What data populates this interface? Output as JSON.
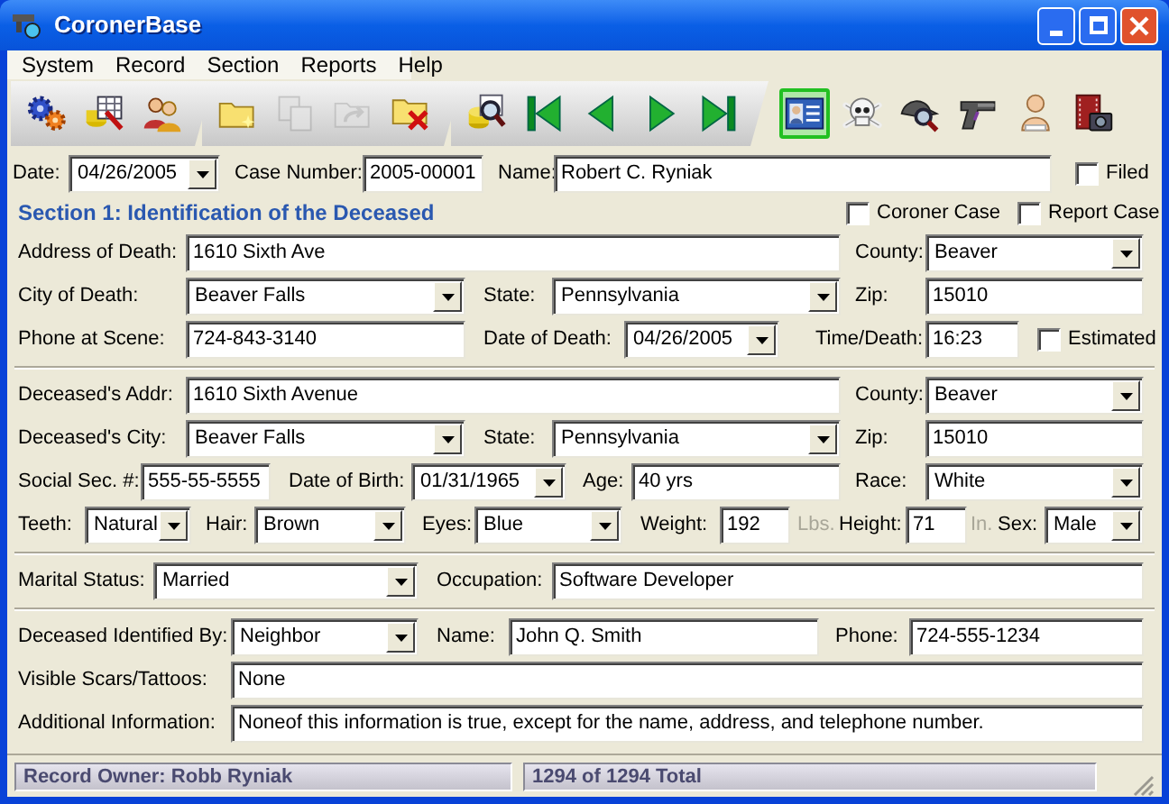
{
  "window": {
    "title": "CoronerBase"
  },
  "menu": [
    {
      "label": "System"
    },
    {
      "label": "Record"
    },
    {
      "label": "Section"
    },
    {
      "label": "Reports"
    },
    {
      "label": "Help"
    }
  ],
  "toolbar": [
    {
      "kind": "panel",
      "buttons": [
        {
          "kind": "gears",
          "disabled": false,
          "selected": false
        },
        {
          "kind": "table",
          "disabled": false,
          "selected": false
        },
        {
          "kind": "people",
          "disabled": false,
          "selected": false
        }
      ]
    },
    {
      "kind": "panel",
      "buttons": [
        {
          "kind": "folder-new",
          "disabled": false,
          "selected": false
        },
        {
          "kind": "copy",
          "disabled": true,
          "selected": false
        },
        {
          "kind": "folder-move",
          "disabled": true,
          "selected": false
        },
        {
          "kind": "folder-delete",
          "disabled": false,
          "selected": false
        }
      ]
    },
    {
      "kind": "panel",
      "buttons": [
        {
          "kind": "search-db",
          "disabled": false,
          "selected": false
        },
        {
          "kind": "first",
          "disabled": false,
          "selected": false
        },
        {
          "kind": "prev",
          "disabled": false,
          "selected": false
        },
        {
          "kind": "next",
          "disabled": false,
          "selected": false
        },
        {
          "kind": "last",
          "disabled": false,
          "selected": false
        }
      ]
    },
    {
      "kind": "flat",
      "buttons": [
        {
          "kind": "id-card",
          "disabled": false,
          "selected": true
        },
        {
          "kind": "skull",
          "disabled": false,
          "selected": false
        },
        {
          "kind": "hat-magnifier",
          "disabled": false,
          "selected": false
        },
        {
          "kind": "pistol",
          "disabled": false,
          "selected": false
        },
        {
          "kind": "baby",
          "disabled": false,
          "selected": false
        },
        {
          "kind": "film-camera",
          "disabled": false,
          "selected": false
        }
      ]
    }
  ],
  "rows": [
    {
      "kind": "fields",
      "items": [
        {
          "kind": "label",
          "text": "Date:"
        },
        {
          "kind": "combo",
          "value": "04/26/2005"
        },
        {
          "kind": "label",
          "text": "Case Number:"
        },
        {
          "kind": "text",
          "value": "2005-00001"
        },
        {
          "kind": "label",
          "text": "Name:"
        },
        {
          "kind": "text",
          "value": "Robert C. Ryniak"
        },
        {
          "kind": "checkbox",
          "label": "Filed",
          "checked": false
        }
      ]
    },
    {
      "kind": "section",
      "items": [
        {
          "kind": "title",
          "text": "Section 1: Identification of the Deceased"
        },
        {
          "kind": "checkbox",
          "label": "Coroner Case",
          "checked": false
        },
        {
          "kind": "checkbox",
          "label": "Report Case",
          "checked": false
        }
      ]
    },
    {
      "kind": "fields",
      "items": [
        {
          "kind": "label",
          "text": "Address of Death:"
        },
        {
          "kind": "text",
          "value": "1610 Sixth Ave"
        },
        {
          "kind": "label",
          "text": "County:"
        },
        {
          "kind": "combo",
          "value": "Beaver"
        }
      ]
    },
    {
      "kind": "fields",
      "items": [
        {
          "kind": "label",
          "text": "City of Death:"
        },
        {
          "kind": "combo",
          "value": "Beaver Falls"
        },
        {
          "kind": "label",
          "text": "State:"
        },
        {
          "kind": "combo",
          "value": "Pennsylvania"
        },
        {
          "kind": "label",
          "text": "Zip:"
        },
        {
          "kind": "text",
          "value": "15010"
        }
      ]
    },
    {
      "kind": "fields",
      "items": [
        {
          "kind": "label",
          "text": "Phone at Scene:"
        },
        {
          "kind": "text",
          "value": "724-843-3140"
        },
        {
          "kind": "label",
          "text": "Date of Death:"
        },
        {
          "kind": "combo",
          "value": "04/26/2005"
        },
        {
          "kind": "label",
          "text": "Time/Death:"
        },
        {
          "kind": "text",
          "value": "16:23"
        },
        {
          "kind": "checkbox",
          "label": "Estimated",
          "checked": false
        }
      ]
    },
    {
      "kind": "divider"
    },
    {
      "kind": "fields",
      "items": [
        {
          "kind": "label",
          "text": "Deceased's Addr:"
        },
        {
          "kind": "text",
          "value": "1610 Sixth Avenue"
        },
        {
          "kind": "label",
          "text": "County:"
        },
        {
          "kind": "combo",
          "value": "Beaver"
        }
      ]
    },
    {
      "kind": "fields",
      "items": [
        {
          "kind": "label",
          "text": "Deceased's City:"
        },
        {
          "kind": "combo",
          "value": "Beaver Falls"
        },
        {
          "kind": "label",
          "text": "State:"
        },
        {
          "kind": "combo",
          "value": "Pennsylvania"
        },
        {
          "kind": "label",
          "text": "Zip:"
        },
        {
          "kind": "text",
          "value": "15010"
        }
      ]
    },
    {
      "kind": "fields",
      "items": [
        {
          "kind": "label",
          "text": "Social Sec. #:"
        },
        {
          "kind": "text",
          "value": "555-55-5555"
        },
        {
          "kind": "label",
          "text": "Date of Birth:"
        },
        {
          "kind": "combo",
          "value": "01/31/1965"
        },
        {
          "kind": "label",
          "text": "Age:"
        },
        {
          "kind": "text",
          "value": "40 yrs"
        },
        {
          "kind": "label",
          "text": "Race:"
        },
        {
          "kind": "combo",
          "value": "White"
        }
      ]
    },
    {
      "kind": "fields",
      "items": [
        {
          "kind": "label",
          "text": "Teeth:"
        },
        {
          "kind": "combo",
          "value": "Natural"
        },
        {
          "kind": "label",
          "text": "Hair:"
        },
        {
          "kind": "combo",
          "value": "Brown"
        },
        {
          "kind": "label",
          "text": "Eyes:"
        },
        {
          "kind": "combo",
          "value": "Blue"
        },
        {
          "kind": "label",
          "text": "Weight:"
        },
        {
          "kind": "text",
          "value": "192"
        },
        {
          "kind": "unit",
          "text": "Lbs."
        },
        {
          "kind": "label",
          "text": "Height:"
        },
        {
          "kind": "text",
          "value": "71"
        },
        {
          "kind": "unit",
          "text": "In."
        },
        {
          "kind": "label",
          "text": "Sex:"
        },
        {
          "kind": "combo",
          "value": "Male"
        }
      ]
    },
    {
      "kind": "divider"
    },
    {
      "kind": "fields",
      "items": [
        {
          "kind": "label",
          "text": "Marital Status:"
        },
        {
          "kind": "combo",
          "value": "Married"
        },
        {
          "kind": "label",
          "text": "Occupation:"
        },
        {
          "kind": "text",
          "value": "Software Developer"
        }
      ]
    },
    {
      "kind": "divider"
    },
    {
      "kind": "fields",
      "items": [
        {
          "kind": "label",
          "text": "Deceased Identified By:"
        },
        {
          "kind": "combo",
          "value": "Neighbor"
        },
        {
          "kind": "label",
          "text": "Name:"
        },
        {
          "kind": "text",
          "value": "John Q. Smith"
        },
        {
          "kind": "label",
          "text": "Phone:"
        },
        {
          "kind": "text",
          "value": "724-555-1234"
        }
      ]
    },
    {
      "kind": "fields",
      "items": [
        {
          "kind": "label",
          "text": "Visible Scars/Tattoos:"
        },
        {
          "kind": "text",
          "value": "None"
        }
      ]
    },
    {
      "kind": "fields",
      "items": [
        {
          "kind": "label",
          "text": "Additional Information:"
        },
        {
          "kind": "text",
          "value": "Noneof this information is true, except for the name, address, and telephone number."
        }
      ]
    }
  ],
  "status_bar": [
    {
      "text": "Record Owner: Robb Ryniak"
    },
    {
      "text": "1294 of 1294 Total"
    }
  ]
}
